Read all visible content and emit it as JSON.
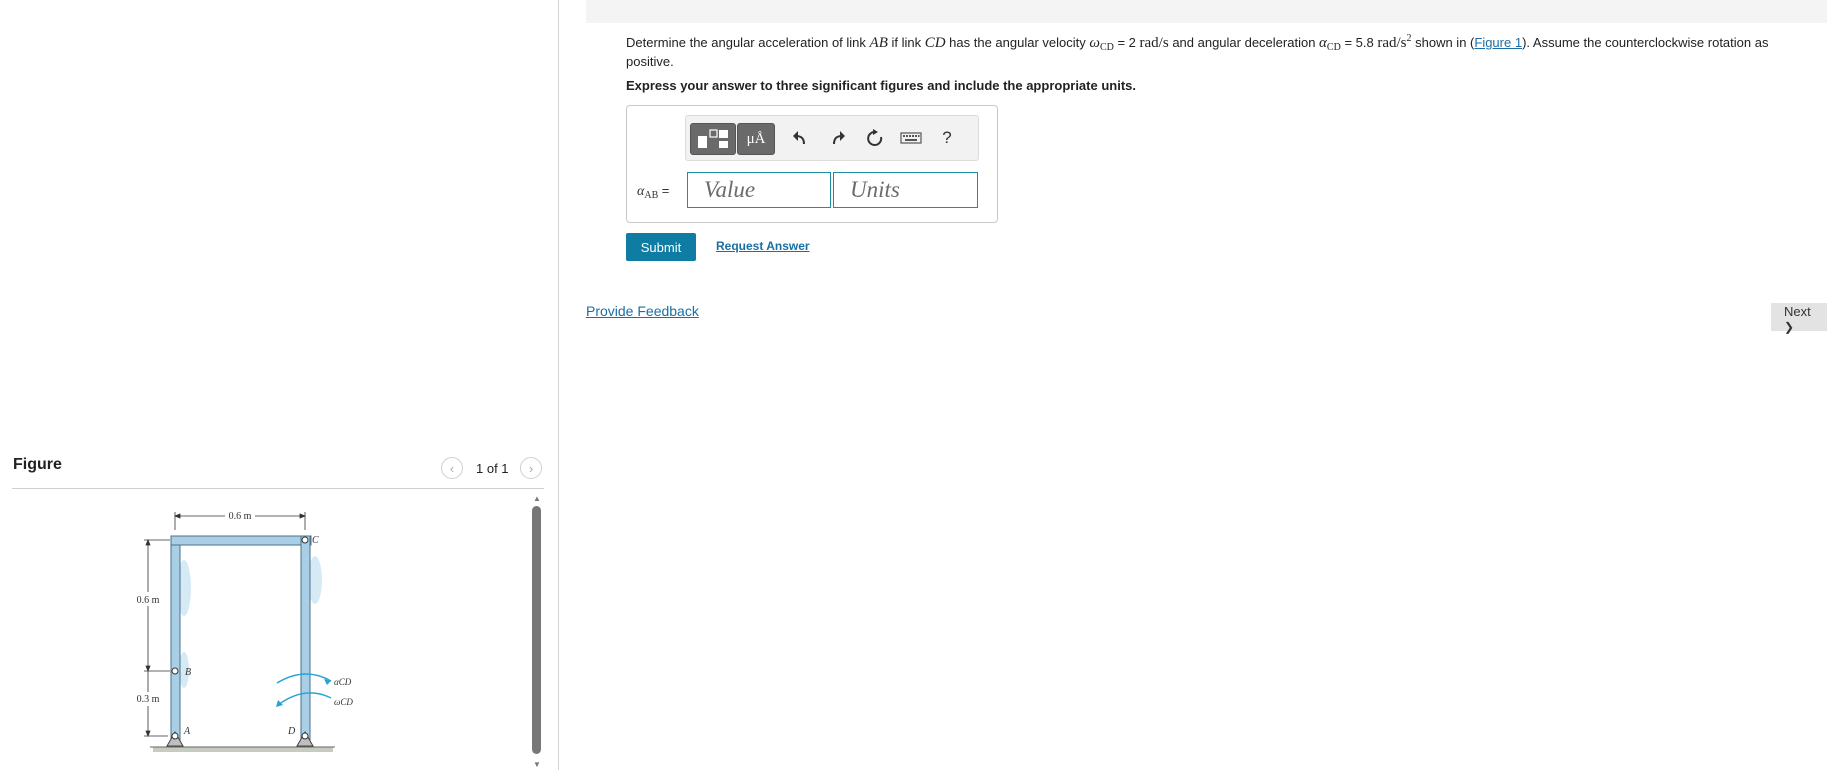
{
  "question": {
    "p1": "Determine the angular acceleration of link ",
    "m1": "AB",
    "p2": " if link ",
    "m2": "CD",
    "p3": " has the angular velocity ",
    "m3": "ω",
    "m3sub": "CD",
    "p4": " = 2 ",
    "u1": "rad/s",
    "p5": " and angular deceleration ",
    "m4": "α",
    "m4sub": "CD",
    "p6": " = 5.8 ",
    "u2": "rad/s",
    "u2sup": "2",
    "p7": " shown in (",
    "figure_link": "Figure 1",
    "p8": "). Assume the counterclockwise rotation as positive.",
    "instruction": "Express your answer to three significant figures and include the appropriate units."
  },
  "answer": {
    "label_var": "α",
    "label_sub": "AB",
    "label_eq": "=",
    "value_placeholder": "Value",
    "units_placeholder": "Units",
    "toolbar": {
      "units_label": "μÅ",
      "undo_label": "↶",
      "redo_label": "↷",
      "reset_label": "↻",
      "help_label": "?"
    }
  },
  "actions": {
    "submit_label": "Submit",
    "request_answer_label": "Request Answer",
    "provide_feedback_label": "Provide Feedback",
    "next_label": "Next",
    "next_chevron": "❯"
  },
  "figure": {
    "heading": "Figure",
    "counter": "1 of 1",
    "prev_symbol": "‹",
    "next_symbol": "›",
    "labels": {
      "width": "0.6 m",
      "height_upper": "0.6 m",
      "height_lower": "0.3 m",
      "point_a": "A",
      "point_b": "B",
      "point_c": "C",
      "point_d": "D",
      "alpha_cd": "αCD",
      "omega_cd": "ωCD"
    }
  },
  "colors": {
    "link_fill": "#a9cfe6",
    "link_stroke": "#4b6f86",
    "arrow_blue": "#29a3d6",
    "button_blue": "#0f7ca3",
    "link_text": "#1a6fa4"
  },
  "icons": [
    "template-icon",
    "units-icon",
    "undo-icon",
    "redo-icon",
    "reset-icon",
    "keyboard-icon",
    "help-icon"
  ]
}
